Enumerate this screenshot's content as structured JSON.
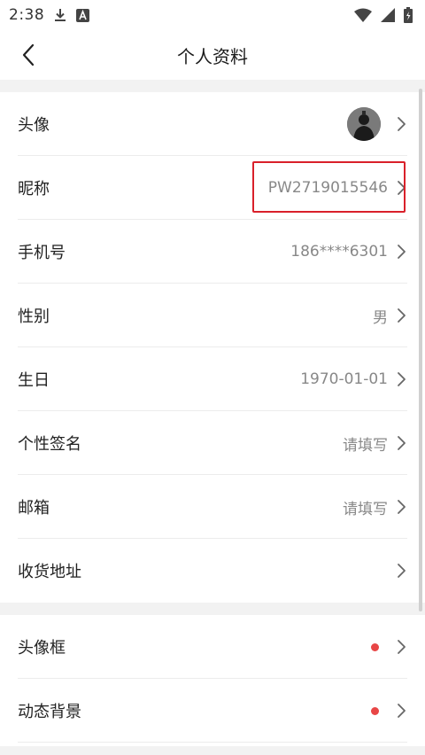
{
  "status": {
    "time": "2:38",
    "icons": [
      "download-icon",
      "a-notification-icon",
      "wifi-icon",
      "signal-icon",
      "battery-icon"
    ]
  },
  "header": {
    "title": "个人资料",
    "back_icon": "chevron-left-icon"
  },
  "rows": [
    {
      "label": "头像",
      "type": "avatar"
    },
    {
      "label": "昵称",
      "value": "PW2719015546"
    },
    {
      "label": "手机号",
      "value": "186****6301"
    },
    {
      "label": "性别",
      "value": "男"
    },
    {
      "label": "生日",
      "value": "1970-01-01"
    },
    {
      "label": "个性签名",
      "value": "请填写"
    },
    {
      "label": "邮箱",
      "value": "请填写"
    },
    {
      "label": "收货地址",
      "value": ""
    }
  ],
  "rows2": [
    {
      "label": "头像框",
      "type": "dot"
    },
    {
      "label": "动态背景",
      "type": "dot"
    }
  ],
  "colors": {
    "highlight": "#d9202a",
    "dot": "#e84646",
    "value_text": "#888888"
  }
}
